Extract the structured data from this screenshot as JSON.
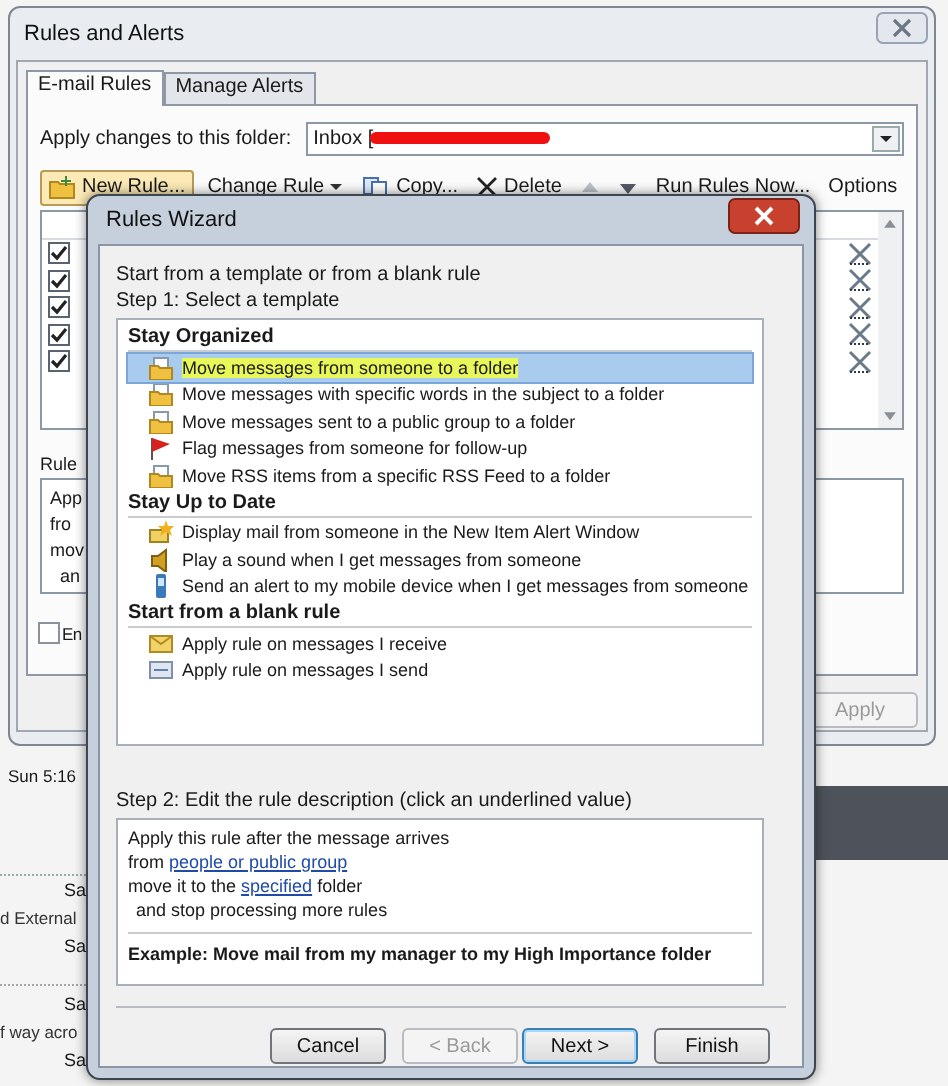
{
  "background_window": {
    "title": "Rules and Alerts",
    "tabs": [
      {
        "label": "E-mail Rules",
        "selected": true
      },
      {
        "label": "Manage Alerts",
        "selected": false
      }
    ],
    "folder_label": "Apply changes to this folder:",
    "folder_value": "Inbox [",
    "toolbar": [
      {
        "kind": "new",
        "label": "New Rule..."
      },
      {
        "kind": "menu",
        "label": "Change Rule"
      },
      {
        "kind": "copy",
        "label": "Copy..."
      },
      {
        "kind": "delete",
        "label": "Delete"
      },
      {
        "kind": "up"
      },
      {
        "kind": "down"
      },
      {
        "kind": "plain",
        "label": "Run Rules Now..."
      },
      {
        "kind": "plain",
        "label": "Options"
      }
    ],
    "rules": [
      {
        "checked": true
      },
      {
        "checked": true
      },
      {
        "checked": true
      },
      {
        "checked": true
      },
      {
        "checked": true
      }
    ],
    "description_label": "Rule",
    "description_lines": [
      "App",
      "fro",
      "mov",
      "an"
    ],
    "enable_checkbox": {
      "label": "En",
      "checked": false
    },
    "apply_button": {
      "label": "Apply",
      "disabled": true
    }
  },
  "mail_list": {
    "date": "Sun 5:16",
    "rows": [
      {
        "kind": "time",
        "text": "Sa"
      },
      {
        "kind": "snippet",
        "text": "d External"
      },
      {
        "kind": "time",
        "text": "Sa"
      },
      {
        "kind": "time",
        "text": "Sa"
      },
      {
        "kind": "snippet",
        "text": "f way acro"
      },
      {
        "kind": "time",
        "text": "Sa"
      }
    ]
  },
  "wizard": {
    "title": "Rules Wizard",
    "intro": "Start from a template or from a blank rule",
    "step1": "Step 1: Select a template",
    "groups": [
      {
        "heading": "Stay Organized",
        "items": [
          {
            "kind": "move",
            "label": "Move messages from someone to a folder",
            "selected": true,
            "highlighted": true
          },
          {
            "kind": "move",
            "label": "Move messages with specific words in the subject to a folder",
            "selected": false,
            "highlighted": false
          },
          {
            "kind": "move",
            "label": "Move messages sent to a public group to a folder",
            "selected": false,
            "highlighted": false
          },
          {
            "kind": "flag",
            "label": "Flag messages from someone for follow-up",
            "selected": false,
            "highlighted": false
          },
          {
            "kind": "move",
            "label": "Move RSS items from a specific RSS Feed to a folder",
            "selected": false,
            "highlighted": false
          }
        ]
      },
      {
        "heading": "Stay Up to Date",
        "items": [
          {
            "kind": "alert",
            "label": "Display mail from someone in the New Item Alert Window",
            "selected": false,
            "highlighted": false
          },
          {
            "kind": "sound",
            "label": "Play a sound when I get messages from someone",
            "selected": false,
            "highlighted": false
          },
          {
            "kind": "mobile",
            "label": "Send an alert to my mobile device when I get messages from someone",
            "selected": false,
            "highlighted": false
          }
        ]
      },
      {
        "heading": "Start from a blank rule",
        "items": [
          {
            "kind": "receive",
            "label": "Apply rule on messages I receive",
            "selected": false,
            "highlighted": false
          },
          {
            "kind": "send",
            "label": "Apply rule on messages I send",
            "selected": false,
            "highlighted": false
          }
        ]
      }
    ],
    "step2": "Step 2: Edit the rule description (click an underlined value)",
    "description": [
      {
        "indented": false,
        "parts": [
          {
            "text": "Apply this rule after the message arrives",
            "link": false
          }
        ]
      },
      {
        "indented": false,
        "parts": [
          {
            "text": "from ",
            "link": false
          },
          {
            "text": "people or public group",
            "link": true
          }
        ]
      },
      {
        "indented": false,
        "parts": [
          {
            "text": "move it to the ",
            "link": false
          },
          {
            "text": "specified",
            "link": true
          },
          {
            "text": " folder",
            "link": false
          }
        ]
      },
      {
        "indented": true,
        "parts": [
          {
            "text": "and stop processing more rules",
            "link": false
          }
        ]
      }
    ],
    "example": "Example: Move mail from my manager to my High Importance folder",
    "buttons": [
      {
        "label": "Cancel",
        "disabled": false,
        "default": false
      },
      {
        "label": "< Back",
        "disabled": true,
        "default": false
      },
      {
        "label": "Next >",
        "disabled": false,
        "default": true
      },
      {
        "label": "Finish",
        "disabled": false,
        "default": false
      }
    ]
  }
}
